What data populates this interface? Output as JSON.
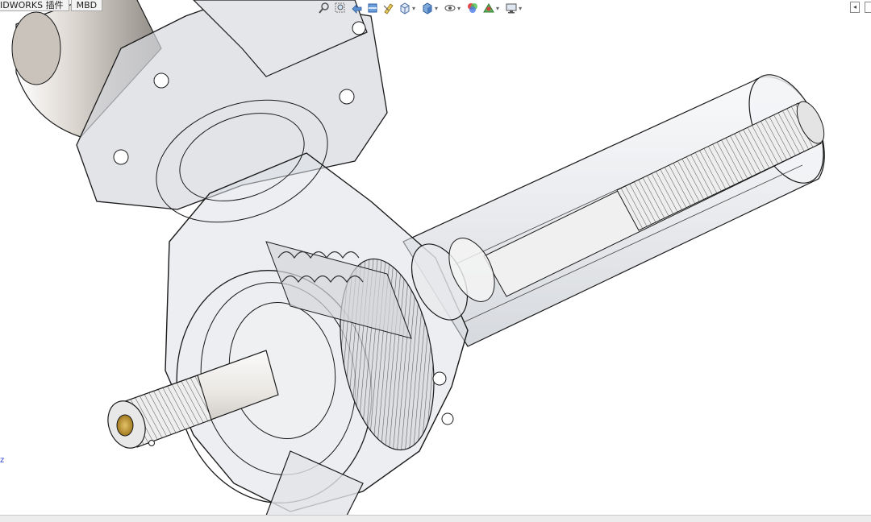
{
  "tabs": [
    {
      "label": "IDWORKS 插件"
    },
    {
      "label": "MBD"
    }
  ],
  "heads_up_toolbar": {
    "buttons": [
      {
        "icon": "zoom-to-fit-icon"
      },
      {
        "icon": "zoom-to-area-icon"
      },
      {
        "icon": "previous-view-icon"
      },
      {
        "icon": "section-view-icon"
      },
      {
        "icon": "dynamic-annotation-icon"
      },
      {
        "icon": "view-orientation-icon",
        "has_menu": true
      },
      {
        "icon": "display-style-icon",
        "has_menu": true
      },
      {
        "icon": "hide-show-items-icon",
        "has_menu": true
      },
      {
        "icon": "edit-appearance-icon"
      },
      {
        "icon": "apply-scene-icon",
        "has_menu": true
      },
      {
        "icon": "view-settings-icon",
        "has_menu": true
      }
    ]
  },
  "viewport": {
    "model": "steering-column-gearbox-assembly",
    "display_mode": "transparent-with-edges",
    "triad_label": "z"
  },
  "colors": {
    "background": "#ffffff",
    "edge": "#1a1a1a",
    "shaded_light": "#eef0f3",
    "shaded_mid": "#c9ccd2",
    "shaded_dark": "#8f939a",
    "bushing": "#b8902e",
    "triad_axis": "#2a3fc8"
  }
}
